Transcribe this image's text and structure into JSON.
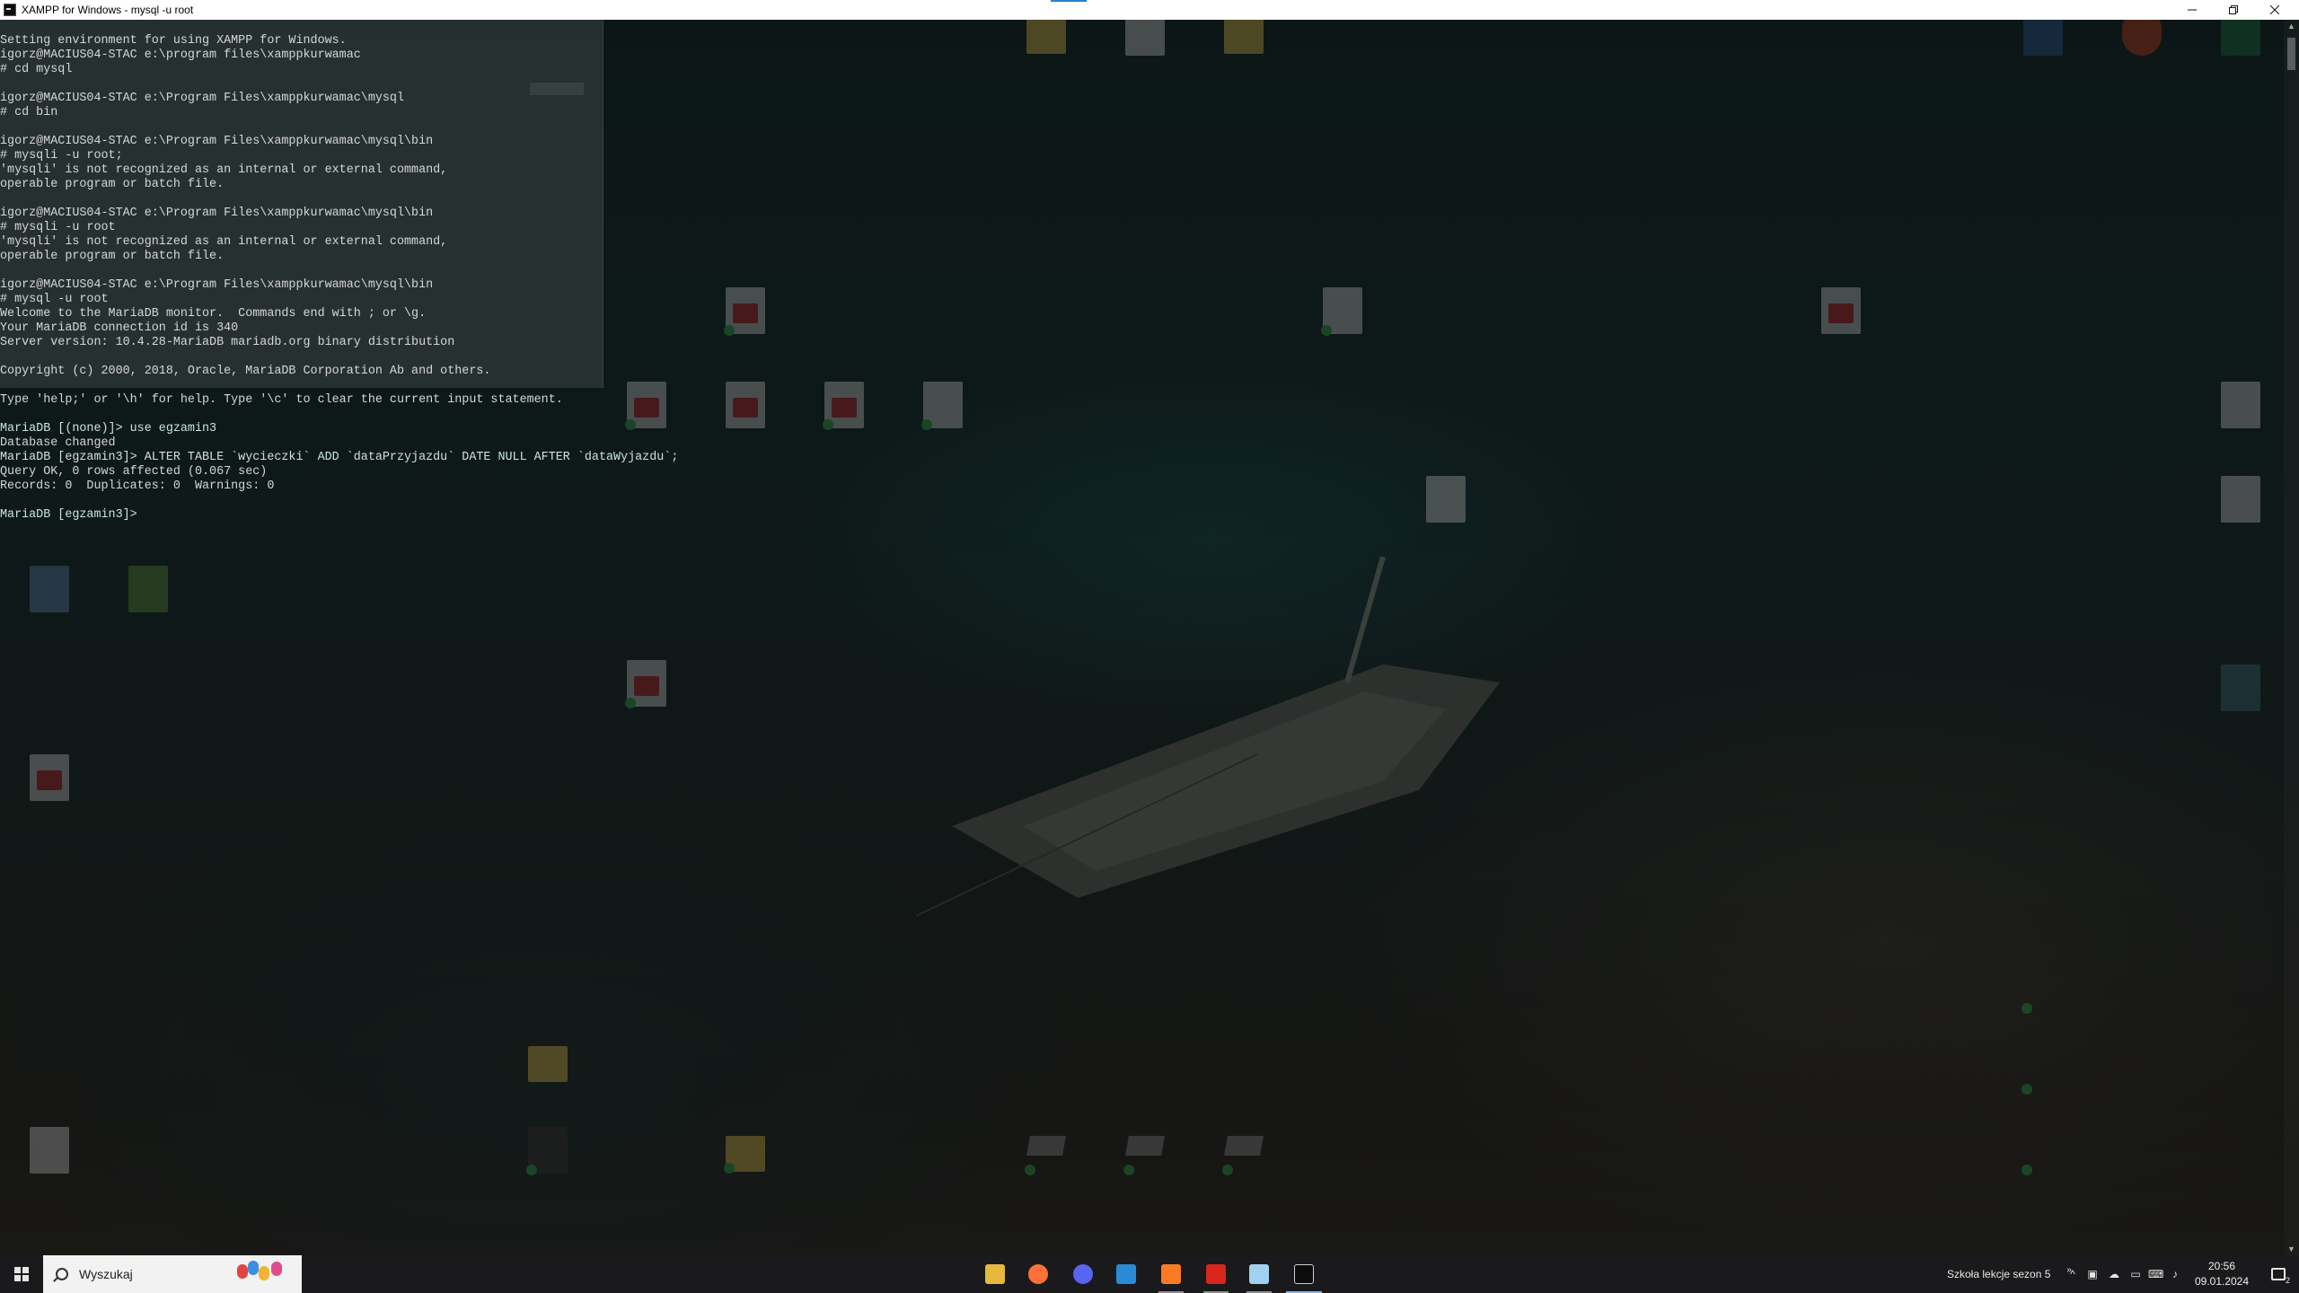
{
  "window": {
    "title": "XAMPP for Windows - mysql  -u root",
    "minimize_icon": "minimize-icon",
    "maximize_icon": "restore-icon",
    "close_icon": "close-icon"
  },
  "console": {
    "lines": [
      "Setting environment for using XAMPP for Windows.",
      "igorz@MACIUS04-STAC e:\\program files\\xamppkurwamac",
      "# cd mysql",
      "",
      "igorz@MACIUS04-STAC e:\\Program Files\\xamppkurwamac\\mysql",
      "# cd bin",
      "",
      "igorz@MACIUS04-STAC e:\\Program Files\\xamppkurwamac\\mysql\\bin",
      "# mysqli -u root;",
      "'mysqli' is not recognized as an internal or external command,",
      "operable program or batch file.",
      "",
      "igorz@MACIUS04-STAC e:\\Program Files\\xamppkurwamac\\mysql\\bin",
      "# mysqli -u root",
      "'mysqli' is not recognized as an internal or external command,",
      "operable program or batch file.",
      "",
      "igorz@MACIUS04-STAC e:\\Program Files\\xamppkurwamac\\mysql\\bin",
      "# mysql -u root",
      "Welcome to the MariaDB monitor.  Commands end with ; or \\g.",
      "Your MariaDB connection id is 340",
      "Server version: 10.4.28-MariaDB mariadb.org binary distribution",
      "",
      "Copyright (c) 2000, 2018, Oracle, MariaDB Corporation Ab and others.",
      "",
      "Type 'help;' or '\\h' for help. Type '\\c' to clear the current input statement.",
      "",
      "MariaDB [(none)]> use egzamin3",
      "Database changed",
      "MariaDB [egzamin3]> ALTER TABLE `wycieczki` ADD `dataPrzyjazdu` DATE NULL AFTER `dataWyjazdu`;",
      "Query OK, 0 rows affected (0.067 sec)",
      "Records: 0  Duplicates: 0  Warnings: 0",
      "",
      "MariaDB [egzamin3]>"
    ]
  },
  "taskbar": {
    "search_placeholder": "Wyszukaj",
    "apps": [
      {
        "name": "file-explorer",
        "icon": "folder-icon",
        "color": "#e7b73e"
      },
      {
        "name": "firefox",
        "icon": "firefox-icon",
        "color": "#ff7139"
      },
      {
        "name": "discord",
        "icon": "discord-icon",
        "color": "#5865f2"
      },
      {
        "name": "vscode",
        "icon": "vscode-icon",
        "color": "#2b8ad6"
      },
      {
        "name": "xampp",
        "icon": "xampp-icon",
        "color": "#fb7a24"
      },
      {
        "name": "acrobat",
        "icon": "acrobat-icon",
        "color": "#d9261c"
      },
      {
        "name": "notepad",
        "icon": "notepad-icon",
        "color": "#9fd2f0"
      },
      {
        "name": "terminal",
        "icon": "terminal-icon",
        "color": "#0c0c0c"
      }
    ],
    "tray_text": "Szkoła lekcje sezon 5",
    "clock_time": "20:56",
    "clock_date": "09.01.2024",
    "notifications_count": "2"
  },
  "colors": {
    "console_text": "#d6d6d6",
    "taskbar_bg": "#1a1a1c",
    "title_bar_bg": "#ffffff"
  }
}
